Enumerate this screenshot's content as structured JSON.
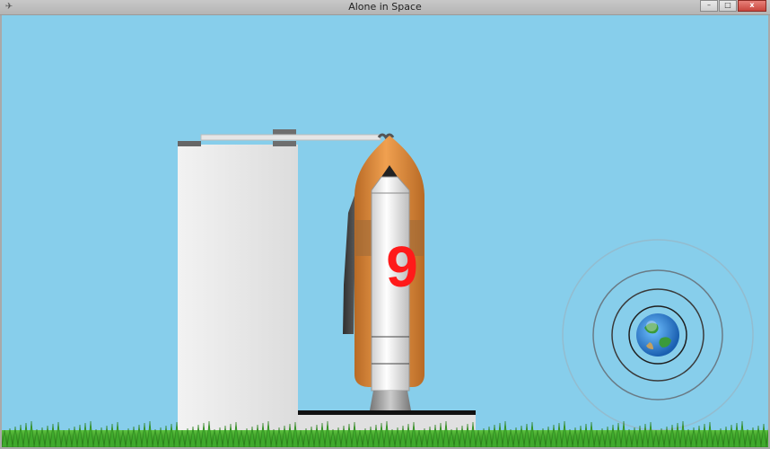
{
  "window": {
    "title": "Alone in Space",
    "minimize_glyph": "–",
    "maximize_glyph": "□",
    "close_glyph": "x"
  },
  "game": {
    "countdown": "9",
    "colors": {
      "sky": "#87ceeb",
      "countdown": "#ff1a1a",
      "fuel_tank": "#d98a3a",
      "tower": "#e8e8e8",
      "grass": "#3a9a2a"
    },
    "icons": {
      "app": "app-icon",
      "planet": "earth-icon"
    }
  }
}
